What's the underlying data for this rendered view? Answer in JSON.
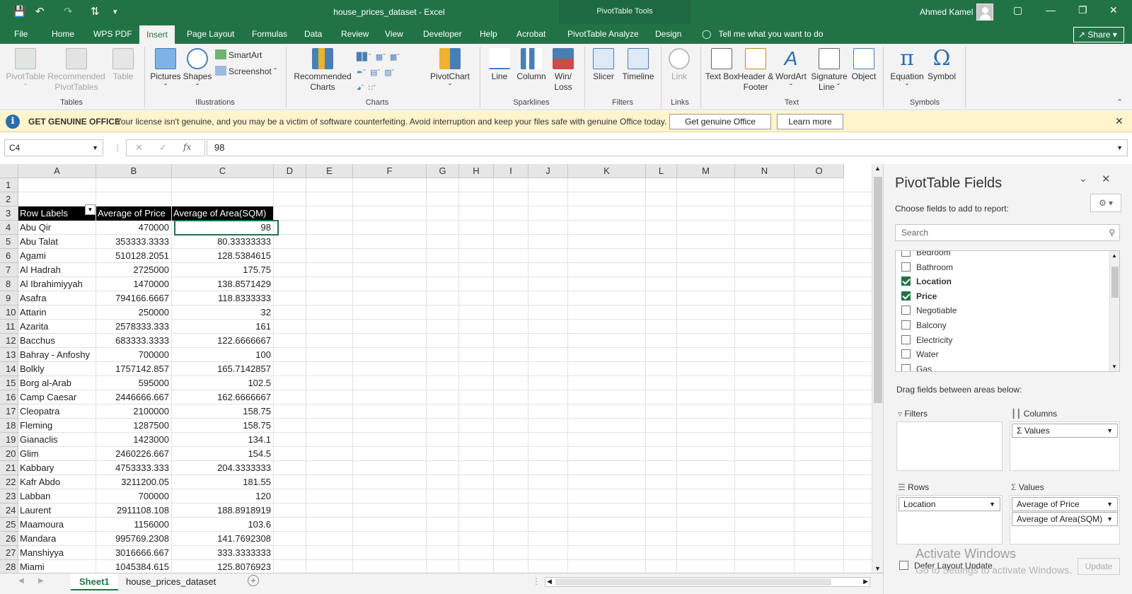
{
  "app": {
    "title": "house_prices_dataset  -  Excel",
    "context_tab_group": "PivotTable Tools",
    "user": "Ahmed Kamel"
  },
  "menu_tabs": [
    "File",
    "Home",
    "WPS PDF",
    "Insert",
    "Page Layout",
    "Formulas",
    "Data",
    "Review",
    "View",
    "Developer",
    "Help",
    "Acrobat",
    "PivotTable Analyze",
    "Design"
  ],
  "active_tab": "Insert",
  "tell_me": "Tell me what you want to do",
  "share": "Share",
  "ribbon": {
    "tables": {
      "label": "Tables",
      "buttons": [
        "PivotTable",
        "Recommended PivotTables",
        "Table"
      ]
    },
    "illustrations": {
      "label": "Illustrations",
      "buttons": [
        "Pictures",
        "Shapes"
      ],
      "small": [
        "SmartArt",
        "Screenshot"
      ]
    },
    "charts": {
      "label": "Charts",
      "buttons": [
        "Recommended Charts",
        "PivotChart"
      ]
    },
    "sparklines": {
      "label": "Sparklines",
      "buttons": [
        "Line",
        "Column",
        "Win/ Loss"
      ]
    },
    "filters": {
      "label": "Filters",
      "buttons": [
        "Slicer",
        "Timeline"
      ]
    },
    "links": {
      "label": "Links",
      "buttons": [
        "Link"
      ]
    },
    "text": {
      "label": "Text",
      "buttons": [
        "Text Box",
        "Header & Footer",
        "WordArt",
        "Signature Line",
        "Object"
      ]
    },
    "symbols": {
      "label": "Symbols",
      "buttons": [
        "Equation",
        "Symbol"
      ]
    }
  },
  "notification": {
    "title": "GET GENUINE OFFICE",
    "message": "Your license isn't genuine, and you may be a victim of software counterfeiting. Avoid interruption and keep your files safe with genuine Office today.",
    "primary_button": "Get genuine Office",
    "secondary_button": "Learn more"
  },
  "formula_bar": {
    "name_box": "C4",
    "fx": "fx",
    "value": "98"
  },
  "grid": {
    "columns": [
      "A",
      "B",
      "C",
      "D",
      "E",
      "F",
      "G",
      "H",
      "I",
      "J",
      "K",
      "L",
      "M",
      "N",
      "O"
    ],
    "row_numbers": [
      "1",
      "2",
      "3",
      "4",
      "5",
      "6",
      "7",
      "8",
      "9",
      "10",
      "11",
      "12",
      "13",
      "14",
      "15",
      "16",
      "17",
      "18",
      "19",
      "20",
      "21",
      "22",
      "23",
      "24",
      "25",
      "26",
      "27",
      "28"
    ],
    "pivot_headers": [
      "Row Labels",
      "Average of Price",
      "Average of Area(SQM)"
    ],
    "pivot_rows": [
      [
        "Abu Qir",
        "470000",
        "98"
      ],
      [
        "Abu Talat",
        "353333.3333",
        "80.33333333"
      ],
      [
        "Agami",
        "510128.2051",
        "128.5384615"
      ],
      [
        "Al Hadrah",
        "2725000",
        "175.75"
      ],
      [
        "Al Ibrahimiyyah",
        "1470000",
        "138.8571429"
      ],
      [
        "Asafra",
        "794166.6667",
        "118.8333333"
      ],
      [
        "Attarin",
        "250000",
        "32"
      ],
      [
        "Azarita",
        "2578333.333",
        "161"
      ],
      [
        "Bacchus",
        "683333.3333",
        "122.6666667"
      ],
      [
        "Bahray - Anfoshy",
        "700000",
        "100"
      ],
      [
        "Bolkly",
        "1757142.857",
        "165.7142857"
      ],
      [
        "Borg al-Arab",
        "595000",
        "102.5"
      ],
      [
        "Camp Caesar",
        "2446666.667",
        "162.6666667"
      ],
      [
        "Cleopatra",
        "2100000",
        "158.75"
      ],
      [
        "Fleming",
        "1287500",
        "158.75"
      ],
      [
        "Gianaclis",
        "1423000",
        "134.1"
      ],
      [
        "Glim",
        "2460226.667",
        "154.5"
      ],
      [
        "Kabbary",
        "4753333.333",
        "204.3333333"
      ],
      [
        "Kafr Abdo",
        "3211200.05",
        "181.55"
      ],
      [
        "Labban",
        "700000",
        "120"
      ],
      [
        "Laurent",
        "2911108.108",
        "188.8918919"
      ],
      [
        "Maamoura",
        "1156000",
        "103.6"
      ],
      [
        "Mandara",
        "995769.2308",
        "141.7692308"
      ],
      [
        "Manshiyya",
        "3016666.667",
        "333.3333333"
      ],
      [
        "Miami",
        "1045384.615",
        "125.8076923"
      ]
    ]
  },
  "sheet_tabs": [
    "Sheet1",
    "house_prices_dataset"
  ],
  "pivot_panel": {
    "title": "PivotTable Fields",
    "subtitle": "Choose fields to add to report:",
    "search_placeholder": "Search",
    "fields": [
      {
        "name": "Bedroom",
        "checked": false
      },
      {
        "name": "Bathroom",
        "checked": false
      },
      {
        "name": "Location",
        "checked": true
      },
      {
        "name": "Price",
        "checked": true
      },
      {
        "name": "Negotiable",
        "checked": false
      },
      {
        "name": "Balcony",
        "checked": false
      },
      {
        "name": "Electricity",
        "checked": false
      },
      {
        "name": "Water",
        "checked": false
      },
      {
        "name": "Gas",
        "checked": false
      }
    ],
    "drag_hint": "Drag fields between areas below:",
    "areas": {
      "filters": {
        "label": "Filters",
        "items": []
      },
      "columns": {
        "label": "Columns",
        "items": [
          "Values"
        ]
      },
      "rows": {
        "label": "Rows",
        "items": [
          "Location"
        ]
      },
      "values": {
        "label": "Values",
        "items": [
          "Average of Price",
          "Average of Area(SQM)"
        ]
      }
    },
    "defer": "Defer Layout Update",
    "update": "Update"
  },
  "watermark": {
    "line1": "Activate Windows",
    "line2": "Go to Settings to activate Windows."
  },
  "colors": {
    "excel_green": "#217346",
    "notify_bg": "#fff4cc"
  }
}
